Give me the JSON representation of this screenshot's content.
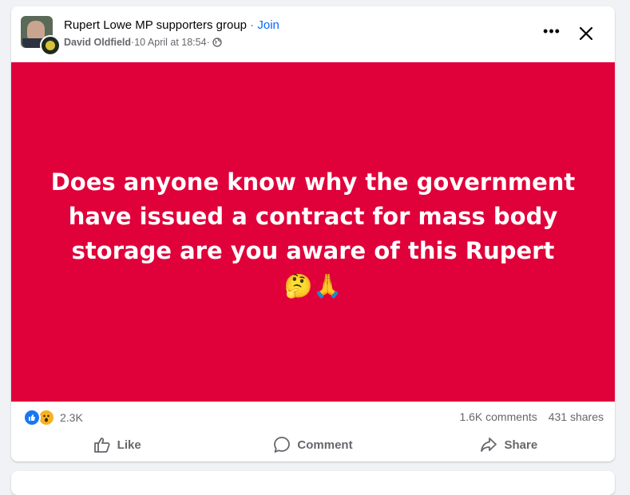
{
  "post": {
    "group_name": "Rupert Lowe MP supporters group",
    "separator": " · ",
    "join_label": "Join",
    "author": "David Oldfield",
    "timestamp": "10 April at 18:54",
    "meta_sep": " · ",
    "body_text": "Does anyone know why the government have issued a contract for mass body storage are you aware of this Rupert",
    "body_emojis": "🤔🙏",
    "background_color": "#e0003a"
  },
  "stats": {
    "reaction_count": "2.3K",
    "comments": "1.6K comments",
    "shares": "431 shares",
    "reaction_icons": [
      "like-icon",
      "wow-icon"
    ]
  },
  "actions": {
    "like_label": "Like",
    "comment_label": "Comment",
    "share_label": "Share"
  },
  "icons": {
    "more": "more-options-icon",
    "close": "close-icon",
    "audience": "globe-icon"
  }
}
